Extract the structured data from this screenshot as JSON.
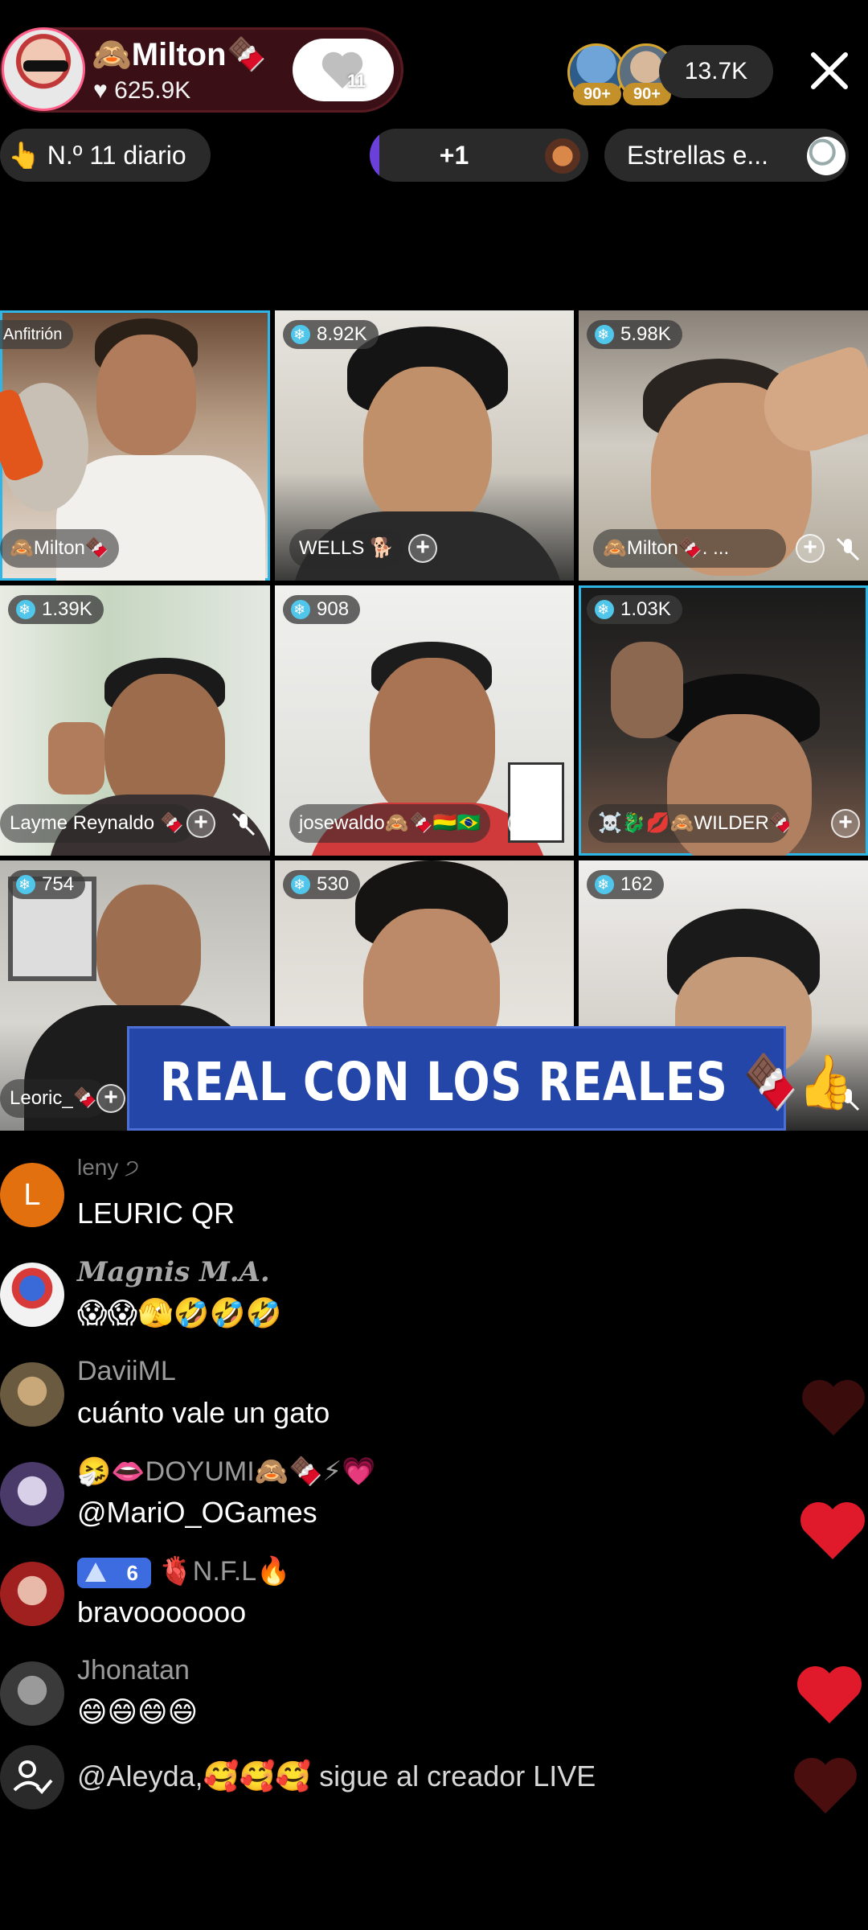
{
  "header": {
    "host_name": "🙈Milton🍫",
    "host_likes": "♥ 625.9K",
    "follow_count": "11",
    "viewer_levels": [
      "90+",
      "90+"
    ],
    "viewer_count": "13.7K",
    "rank_label": "👆 N.º 11 diario",
    "plus_label": "+1",
    "stars_label": "Estrellas e..."
  },
  "grid": {
    "host_tag": "Anfitrión",
    "tiles": [
      {
        "score": "",
        "name": "🙈Milton🍫"
      },
      {
        "score": "8.92K",
        "name": "WELLS 🐕"
      },
      {
        "score": "5.98K",
        "name": "🙈Milton🍫.        ..."
      },
      {
        "score": "1.39K",
        "name": "Layme Reynaldo 🍫"
      },
      {
        "score": "908",
        "name": "josewaldo🙈🍫🇧🇴🇧🇷"
      },
      {
        "score": "1.03K",
        "name": "☠️🐉💋🙈WILDER🍫..."
      },
      {
        "score": "754",
        "name": "Leoric_🍫"
      },
      {
        "score": "530",
        "name": ""
      },
      {
        "score": "162",
        "name": ""
      }
    ],
    "banner": "REAL CON LOS REALES 🍫👍"
  },
  "comments": [
    {
      "user": "leny ੭",
      "message": "LEURIC QR",
      "avatar_letter": "L",
      "color": "#e2700f"
    },
    {
      "user": "Magnis M.A.",
      "message": "😱😱🫣🤣🤣🤣",
      "color": "#f0f0f0"
    },
    {
      "user": "DaviiML",
      "message": "cuánto vale un gato",
      "color": "#8a7b62"
    },
    {
      "user": "🤧👄DOYUMI🙈🍫⚡💗",
      "message": "@MariO_OGames",
      "color": "#4a3a6a"
    },
    {
      "user": "🫀N.F.L🔥",
      "level": "6",
      "message": "bravooooooo",
      "color": "#a02020"
    },
    {
      "user": "Jhonatan",
      "message": "😄😄😄😄",
      "color": "#555555"
    },
    {
      "user": "",
      "message": "@Aleyda,🥰🥰🥰 sigue al creador LIVE",
      "color": "#2a2a2a"
    }
  ],
  "colors": {
    "accent_blue": "#2fb5e6",
    "banner_blue": "#2346a8",
    "heart_red": "#e01a2a",
    "pill_gray": "#2a2a2a"
  }
}
